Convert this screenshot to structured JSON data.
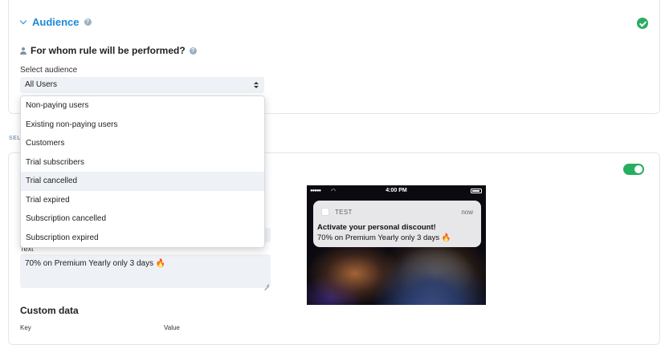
{
  "audience": {
    "section_title": "Audience",
    "question": "For whom rule will be performed?",
    "select_label": "Select audience",
    "selected_value": "All Users",
    "options": [
      "Non-paying users",
      "Existing non-paying users",
      "Customers",
      "Trial subscribers",
      "Trial cancelled",
      "Trial expired",
      "Subscription cancelled",
      "Subscription expired"
    ],
    "highlighted_option": "Trial cancelled",
    "status": "complete"
  },
  "hidden_section_fragment": "SEL",
  "message": {
    "enabled": true,
    "text_label": "Text",
    "text_value": "70% on Premium Yearly only 3 days 🔥",
    "custom_data_title": "Custom data",
    "key_label_fragment": "Key",
    "value_label_fragment": "Value"
  },
  "preview": {
    "status_time": "4:00 PM",
    "signal": "●●●●●",
    "app_name": "TEST",
    "notification_time": "now",
    "notification_title": "Activate your personal discount!",
    "notification_body": "70% on Premium Yearly only 3 days 🔥"
  },
  "colors": {
    "accent_blue": "#1d8ad8",
    "success_green": "#27ae60",
    "field_bg": "#eef1f5"
  }
}
